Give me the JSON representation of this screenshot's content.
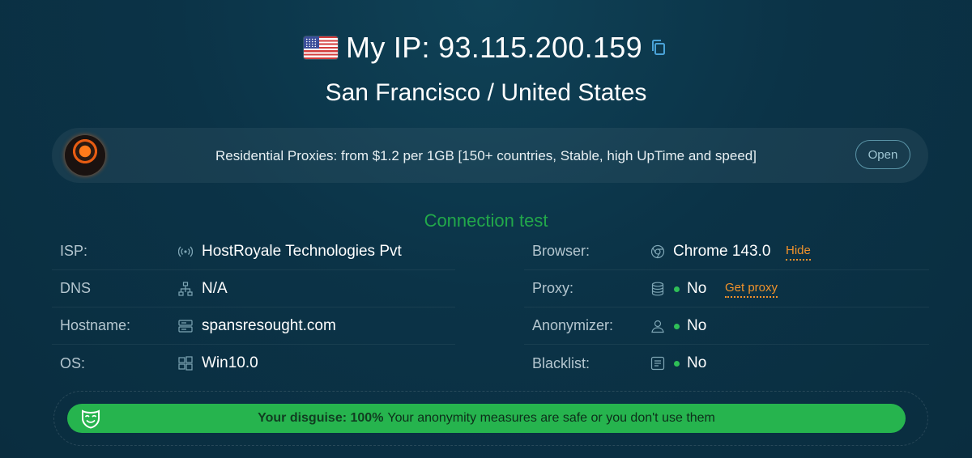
{
  "header": {
    "ip_label": "My IP: 93.115.200.159",
    "location": "San Francisco / United States",
    "flag_icon": "us-flag-icon"
  },
  "promo": {
    "text": "Residential Proxies: from $1.2 per 1GB [150+ countries, Stable, high UpTime and speed]",
    "button": "Open"
  },
  "connection": {
    "title": "Connection test",
    "left": [
      {
        "label": "ISP:",
        "value": "HostRoyale Technologies Pvt",
        "icon": "signal-icon"
      },
      {
        "label": "DNS",
        "value": "N/A",
        "icon": "network-icon"
      },
      {
        "label": "Hostname:",
        "value": "spansresought.com",
        "icon": "server-icon"
      },
      {
        "label": "OS:",
        "value": "Win10.0",
        "icon": "windows-icon"
      }
    ],
    "right": [
      {
        "label": "Browser:",
        "value": "Chrome 143.0",
        "icon": "chrome-icon",
        "link": "Hide"
      },
      {
        "label": "Proxy:",
        "value": "No",
        "icon": "database-icon",
        "link": "Get proxy"
      },
      {
        "label": "Anonymizer:",
        "value": "No",
        "icon": "user-icon"
      },
      {
        "label": "Blacklist:",
        "value": "No",
        "icon": "list-icon"
      }
    ]
  },
  "disguise": {
    "label": "Your disguise: 100%",
    "message": "Your anonymity measures are safe or you don't use them"
  },
  "colors": {
    "accent_green": "#26b44e",
    "link_orange": "#f0922b",
    "title_green": "#22a84a"
  }
}
